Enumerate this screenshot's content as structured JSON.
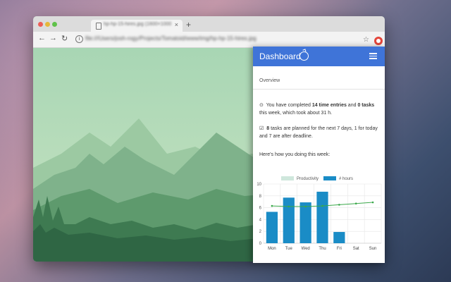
{
  "browser": {
    "tab_title": "hp-hp-15-hires.jpg (1600×1000)",
    "tab_close": "×",
    "new_tab": "+",
    "url": "file:///Users/josh-rogy/Projects/Tomatoid/www/img/hp-hp-15-hires.jpg",
    "nav_back": "←",
    "nav_forward": "→",
    "nav_reload": "↻",
    "info_icon": "i",
    "star_icon": "☆",
    "menu_icon": "⋮"
  },
  "panel": {
    "title": "Dashboard",
    "section": "Overview",
    "summary1": {
      "icon": "⊙",
      "pre": "You have completed ",
      "entries": "14 time entries",
      "mid": " and ",
      "tasks": "0 tasks",
      "post": " this week, which took about 31 h."
    },
    "summary2": {
      "icon": "☑",
      "count": "8",
      "pre": " tasks are planned for the next 7 days, 1 for today and 7 are after deadline."
    },
    "howdoing": "Here's how you doing this week:"
  },
  "chart_data": {
    "type": "bar",
    "categories": [
      "Mon",
      "Tue",
      "Wed",
      "Thu",
      "Fri",
      "Sat",
      "Sun"
    ],
    "series": [
      {
        "name": "# hours",
        "type": "bar",
        "color": "#1a8cc6",
        "values": [
          5.3,
          7.7,
          6.9,
          8.7,
          1.9,
          0,
          0
        ]
      },
      {
        "name": "Productivity",
        "type": "line",
        "color": "#3aa84a",
        "legend_color": "#cfe7dc",
        "values": [
          6.3,
          6.2,
          6.2,
          6.3,
          6.5,
          6.7,
          6.9
        ]
      }
    ],
    "ylim": [
      0,
      10
    ],
    "yticks": [
      0,
      2,
      4,
      6,
      8,
      10
    ],
    "grid": true,
    "legend": "top"
  }
}
